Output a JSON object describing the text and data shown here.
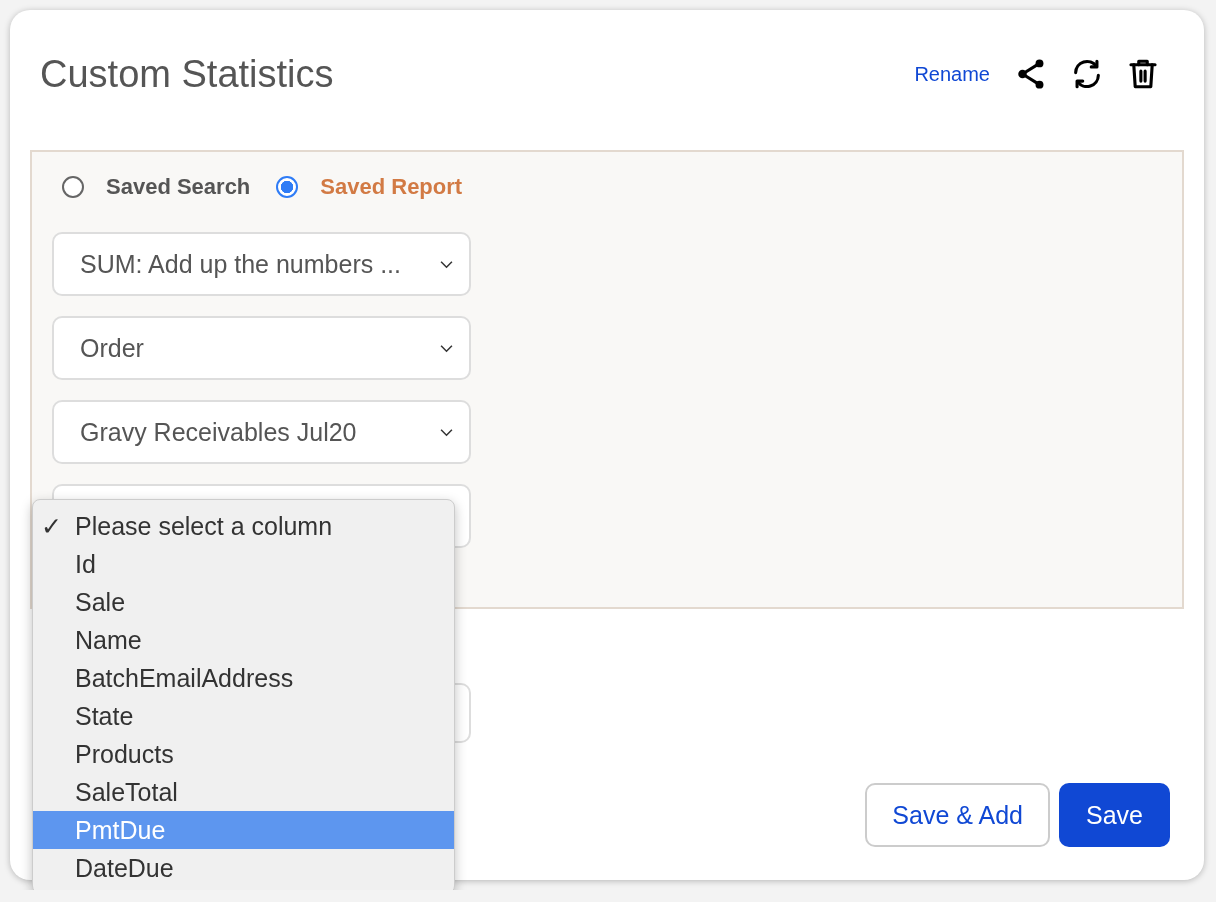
{
  "card": {
    "title": "Custom Statistics",
    "actions": {
      "rename": "Rename"
    }
  },
  "source": [
    {
      "label": "Saved Search",
      "selected": false
    },
    {
      "label": "Saved Report",
      "selected": true
    }
  ],
  "selects": [
    {
      "value": "SUM: Add up the numbers ..."
    },
    {
      "value": "Order"
    },
    {
      "value": "Gravy Receivables Jul20"
    }
  ],
  "column_menu": {
    "check_mark": "✓",
    "options": [
      {
        "label": "Please select a column",
        "checked": true,
        "selected": false
      },
      {
        "label": "Id",
        "checked": false,
        "selected": false
      },
      {
        "label": "Sale",
        "checked": false,
        "selected": false
      },
      {
        "label": "Name",
        "checked": false,
        "selected": false
      },
      {
        "label": "BatchEmailAddress",
        "checked": false,
        "selected": false
      },
      {
        "label": "State",
        "checked": false,
        "selected": false
      },
      {
        "label": "Products",
        "checked": false,
        "selected": false
      },
      {
        "label": "SaleTotal",
        "checked": false,
        "selected": false
      },
      {
        "label": "PmtDue",
        "checked": false,
        "selected": true
      },
      {
        "label": "DateDue",
        "checked": false,
        "selected": false
      }
    ]
  },
  "buttons": [
    {
      "label": "Save & Add",
      "kind": "secondary"
    },
    {
      "label": "Save",
      "kind": "primary"
    }
  ]
}
